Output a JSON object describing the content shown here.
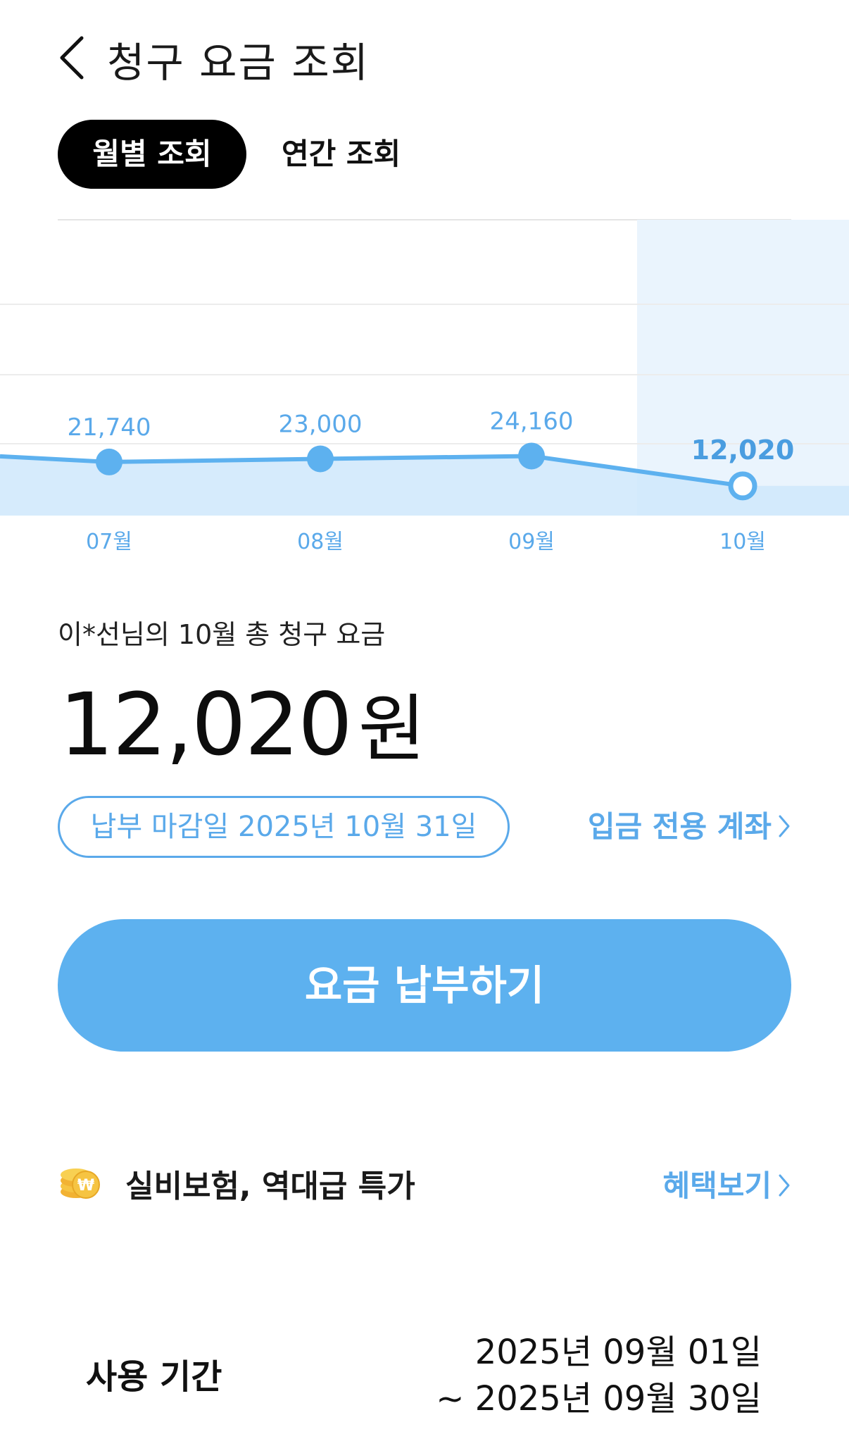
{
  "header": {
    "title": "청구 요금 조회",
    "back_icon": "chevron-left-icon"
  },
  "tabs": [
    {
      "label": "월별 조회",
      "active": true
    },
    {
      "label": "연간 조회",
      "active": false
    }
  ],
  "chart_data": {
    "type": "area",
    "categories": [
      "07월",
      "08월",
      "09월",
      "10월"
    ],
    "values": [
      21740,
      23000,
      24160,
      12020
    ],
    "data_labels": [
      "21,740",
      "23,000",
      "24,160",
      "12,020"
    ],
    "selected_index": 3,
    "ylim": [
      0,
      120000
    ],
    "colors": {
      "line": "#5db1ef",
      "fill": "#cfe8fb",
      "highlight": "#eaf4fd",
      "label": "#5aa9ea",
      "selected_label": "#4a9de0",
      "grid": "#ececec"
    }
  },
  "summary": {
    "label": "이*선님의 10월 총 청구 요금",
    "amount": "12,020",
    "unit": "원",
    "due_date": "납부 마감일 2025년 10월 31일",
    "deposit_link": "입금 전용 계좌"
  },
  "pay_button": {
    "label": "요금 납부하기"
  },
  "promo": {
    "icon": "coin-won-icon",
    "text": "실비보험, 역대급 특가",
    "link": "혜택보기"
  },
  "period": {
    "label": "사용 기간",
    "start": "2025년 09월 01일",
    "end": "~ 2025년 09월 30일"
  },
  "colors": {
    "accent": "#5aa9ea",
    "button": "#5db1ef",
    "tab_active_bg": "#000000"
  }
}
